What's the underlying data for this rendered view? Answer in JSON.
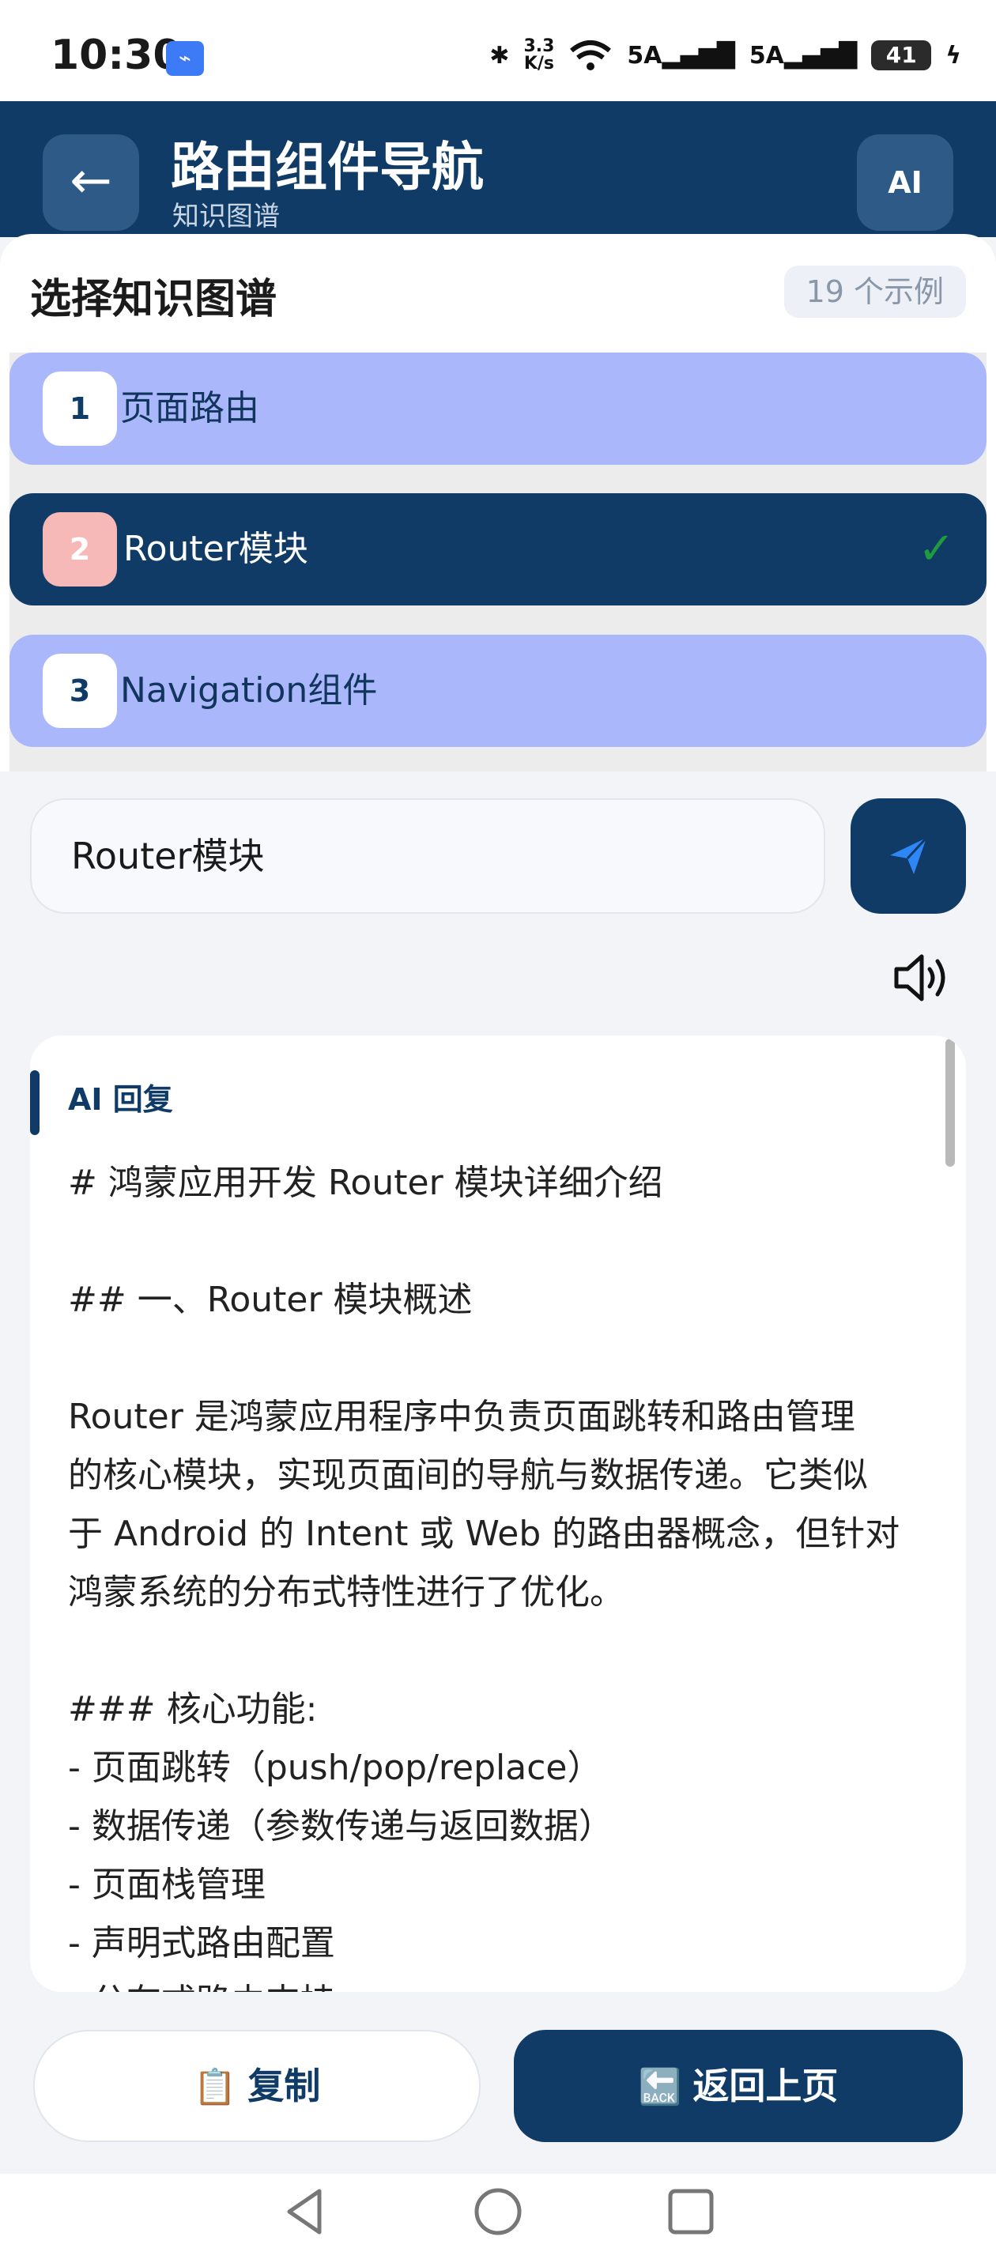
{
  "status_bar": {
    "time": "10:30",
    "speed_top": "3.3",
    "speed_bottom": "K/s",
    "signal1": "5A",
    "signal2": "5A",
    "battery": "41",
    "icons": [
      "usb-icon",
      "bluetooth-icon",
      "wifi-icon",
      "signal-icon",
      "battery-icon",
      "charging-icon"
    ]
  },
  "header": {
    "back_icon": "←",
    "title": "路由组件导航",
    "subtitle": "知识图谱",
    "ai_label": "AI"
  },
  "selector": {
    "title": "选择知识图谱",
    "count": "19 个示例",
    "items": [
      {
        "num": "1",
        "label": "页面路由",
        "selected": false
      },
      {
        "num": "2",
        "label": "Router模块",
        "selected": true
      },
      {
        "num": "3",
        "label": "Navigation组件",
        "selected": false
      },
      {
        "num": "",
        "label": "",
        "selected": false
      }
    ],
    "check_mark": "✓"
  },
  "input": {
    "value": "Router模块"
  },
  "reply": {
    "label": "AI 回复",
    "lines": [
      "# 鸿蒙应用开发 Router 模块详细介绍",
      "",
      "## 一、Router 模块概述",
      "",
      "Router 是鸿蒙应用程序中负责页面跳转和路由管理",
      "的核心模块，实现页面间的导航与数据传递。它类似",
      "于 Android 的 Intent 或 Web 的路由器概念，但针对",
      "鸿蒙系统的分布式特性进行了优化。",
      "",
      "### 核心功能:",
      "- 页面跳转（push/pop/replace）",
      "- 数据传递（参数传递与返回数据）",
      "- 页面栈管理",
      "- 声明式路由配置",
      "- 分布式路由支持"
    ]
  },
  "actions": {
    "copy_emoji": "📋",
    "copy_label": "复制",
    "back_emoji": "🔙",
    "back_label": "返回上页"
  },
  "colors": {
    "primary": "#0f3b66",
    "list_item": "#aab8fb",
    "check": "#1f9a3e",
    "badge_selected": "#f7b8b8"
  }
}
